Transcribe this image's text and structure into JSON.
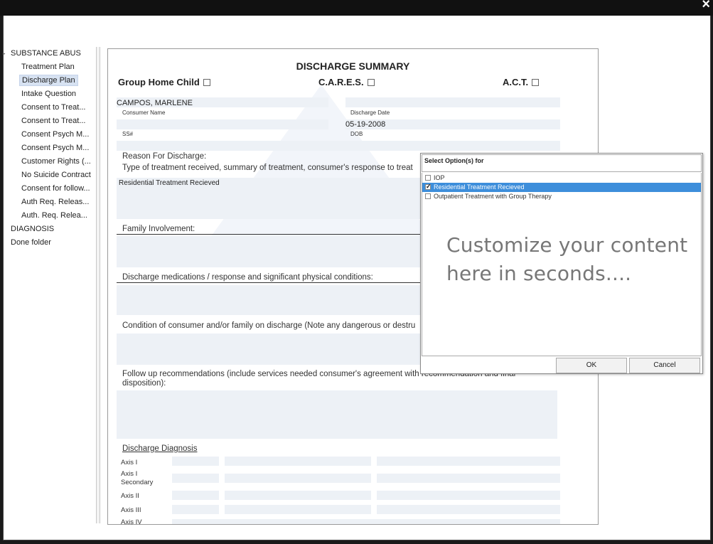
{
  "window": {
    "close_label": "×"
  },
  "sidebar": {
    "groups": [
      {
        "label": "SUBSTANCE ABUS"
      },
      {
        "label": "DIAGNOSIS"
      },
      {
        "label": "Done folder"
      }
    ],
    "items": [
      {
        "label": "Treatment Plan"
      },
      {
        "label": "Discharge Plan"
      },
      {
        "label": "Intake Question"
      },
      {
        "label": "Consent to Treat..."
      },
      {
        "label": "Consent to Treat..."
      },
      {
        "label": "Consent Psych M..."
      },
      {
        "label": "Consent Psych M..."
      },
      {
        "label": "Customer Rights (..."
      },
      {
        "label": "No Suicide Contract"
      },
      {
        "label": "Consent for follow..."
      },
      {
        "label": "Auth Req. Releas..."
      },
      {
        "label": "Auth. Req. Relea..."
      }
    ],
    "selected_index": 1
  },
  "doc": {
    "title": "DISCHARGE SUMMARY",
    "check_group_home": "Group Home Child",
    "check_cares": "C.A.R.E.S.",
    "check_act": "A.C.T.",
    "consumer_name_value": "CAMPOS, MARLENE",
    "consumer_name_label": "Consumer Name",
    "discharge_date_label": "Discharge Date",
    "discharge_date_value": "05-19-2008",
    "ssn_label": "SS#",
    "dob_label": "DOB",
    "reason_heading": "Reason For Discharge:",
    "reason_subheading": "Type of treatment received, summary of treatment, consumer's response to treat",
    "reason_value": "Residential Treatment Recieved",
    "family_heading": "Family Involvement:",
    "meds_heading": "Discharge medications / response and significant physical conditions:",
    "condition_heading": "Condition of consumer and/or family on discharge (Note any dangerous or destru",
    "followup_heading": "Follow up recommendations (include services needed consumer's agreement with recommendation and final disposition):",
    "diagnosis_heading": "Discharge Diagnosis",
    "axes": [
      "Axis I",
      "Axis I Secondary",
      "Axis II",
      "Axis III",
      "Axis IV"
    ]
  },
  "popup": {
    "title": "Select Option(s) for",
    "options": [
      {
        "label": "IOP",
        "checked": false
      },
      {
        "label": "Residential Treatment Recieved",
        "checked": true
      },
      {
        "label": "Outpatient Treatment with Group Therapy",
        "checked": false
      }
    ],
    "promo_line1": "Customize your content",
    "promo_line2": "here in seconds....",
    "ok_label": "OK",
    "cancel_label": "Cancel"
  },
  "colors": {
    "accent": "#3d8edb",
    "field_bg": "#edf1f6",
    "selected_item": "#d7e2f2"
  }
}
